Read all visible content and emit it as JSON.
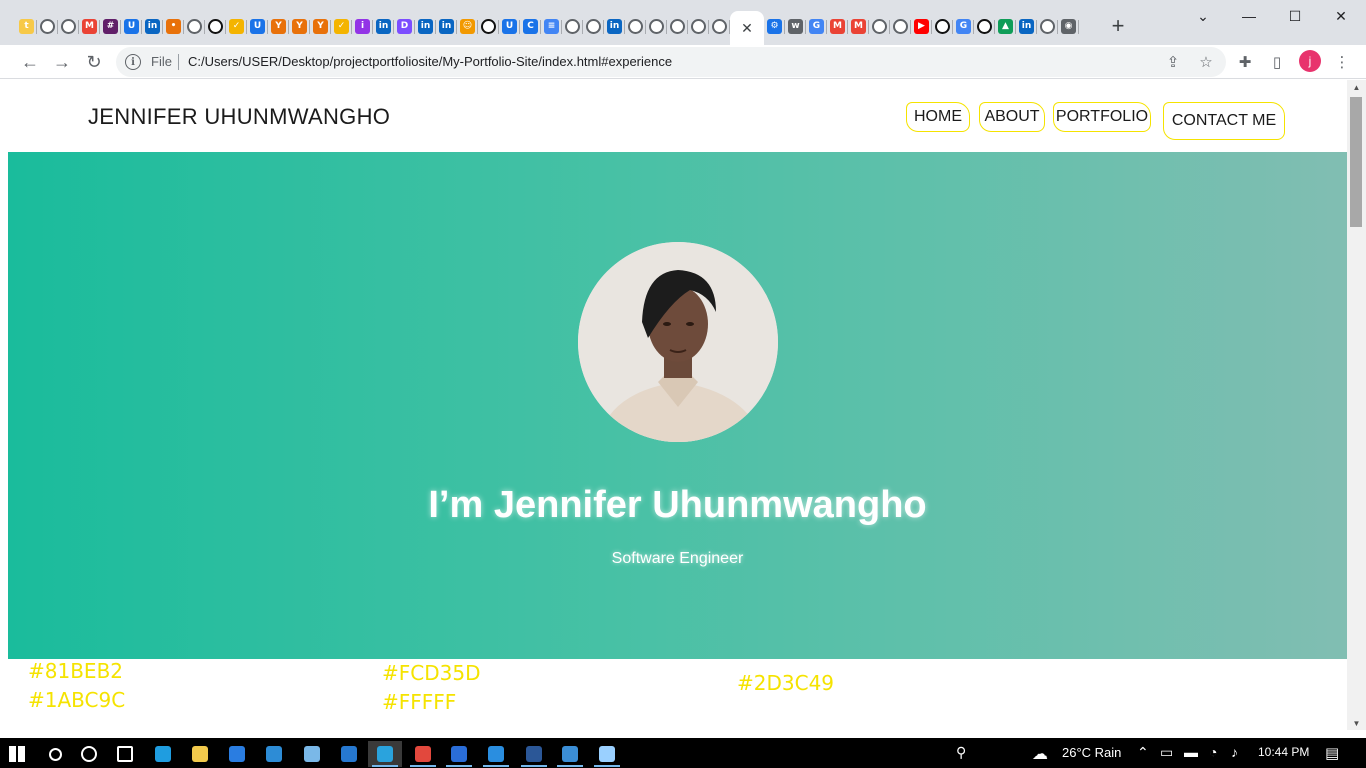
{
  "browser": {
    "tab_favicons": [
      {
        "name": "tumblr-icon",
        "glyph": "t",
        "color": "#f7c948",
        "kind": "solid"
      },
      {
        "name": "globe-icon",
        "glyph": "",
        "color": "#5f6368",
        "kind": "globe"
      },
      {
        "name": "globe-icon",
        "glyph": "",
        "color": "#5f6368",
        "kind": "globe"
      },
      {
        "name": "gmail-icon",
        "glyph": "M",
        "color": "#ea4335",
        "kind": "solid"
      },
      {
        "name": "slack-icon",
        "glyph": "#",
        "color": "#611f69",
        "kind": "solid"
      },
      {
        "name": "udemy-icon",
        "glyph": "U",
        "color": "#1a73e8",
        "kind": "solid"
      },
      {
        "name": "linkedin-icon",
        "glyph": "in",
        "color": "#0a66c2",
        "kind": "solid"
      },
      {
        "name": "app-icon",
        "glyph": "•",
        "color": "#e8710a",
        "kind": "solid"
      },
      {
        "name": "globe-icon",
        "glyph": "",
        "color": "#5f6368",
        "kind": "globe"
      },
      {
        "name": "github-icon",
        "glyph": "",
        "color": "#111",
        "kind": "gh"
      },
      {
        "name": "app-icon",
        "glyph": "✓",
        "color": "#f4b400",
        "kind": "solid"
      },
      {
        "name": "udemy-icon",
        "glyph": "U",
        "color": "#1a73e8",
        "kind": "solid"
      },
      {
        "name": "app-icon",
        "glyph": "Y",
        "color": "#e8710a",
        "kind": "solid"
      },
      {
        "name": "app-icon",
        "glyph": "Y",
        "color": "#e8710a",
        "kind": "solid"
      },
      {
        "name": "app-icon",
        "glyph": "Y",
        "color": "#e8710a",
        "kind": "solid"
      },
      {
        "name": "app-icon",
        "glyph": "✓",
        "color": "#f4b400",
        "kind": "solid"
      },
      {
        "name": "app-icon",
        "glyph": "i",
        "color": "#9334e6",
        "kind": "solid"
      },
      {
        "name": "linkedin-icon",
        "glyph": "in",
        "color": "#0a66c2",
        "kind": "solid"
      },
      {
        "name": "app-icon",
        "glyph": "D",
        "color": "#7c4dff",
        "kind": "solid"
      },
      {
        "name": "linkedin-icon",
        "glyph": "in",
        "color": "#0a66c2",
        "kind": "solid"
      },
      {
        "name": "linkedin-icon",
        "glyph": "in",
        "color": "#0a66c2",
        "kind": "solid"
      },
      {
        "name": "app-icon",
        "glyph": "☺",
        "color": "#f29900",
        "kind": "solid"
      },
      {
        "name": "github-icon",
        "glyph": "",
        "color": "#111",
        "kind": "gh"
      },
      {
        "name": "udemy-icon",
        "glyph": "U",
        "color": "#1a73e8",
        "kind": "solid"
      },
      {
        "name": "app-icon",
        "glyph": "C",
        "color": "#1a73e8",
        "kind": "solid"
      },
      {
        "name": "docs-icon",
        "glyph": "≡",
        "color": "#4285f4",
        "kind": "solid"
      },
      {
        "name": "globe-icon",
        "glyph": "",
        "color": "#5f6368",
        "kind": "globe"
      },
      {
        "name": "globe-icon",
        "glyph": "",
        "color": "#5f6368",
        "kind": "globe"
      },
      {
        "name": "linkedin-icon",
        "glyph": "in",
        "color": "#0a66c2",
        "kind": "solid"
      },
      {
        "name": "globe-icon",
        "glyph": "",
        "color": "#5f6368",
        "kind": "globe"
      },
      {
        "name": "globe-icon",
        "glyph": "",
        "color": "#5f6368",
        "kind": "globe"
      },
      {
        "name": "globe-icon",
        "glyph": "",
        "color": "#5f6368",
        "kind": "globe"
      },
      {
        "name": "globe-icon",
        "glyph": "",
        "color": "#5f6368",
        "kind": "globe"
      },
      {
        "name": "globe-icon",
        "glyph": "",
        "color": "#5f6368",
        "kind": "globe"
      }
    ],
    "tab_favicons_after": [
      {
        "name": "settings-icon",
        "glyph": "⚙",
        "color": "#1a73e8",
        "kind": "solid"
      },
      {
        "name": "app-icon",
        "glyph": "w",
        "color": "#5f6368",
        "kind": "solid"
      },
      {
        "name": "google-icon",
        "glyph": "G",
        "color": "#4285f4",
        "kind": "solid"
      },
      {
        "name": "gmail-icon",
        "glyph": "M",
        "color": "#ea4335",
        "kind": "solid"
      },
      {
        "name": "gmail-icon",
        "glyph": "M",
        "color": "#ea4335",
        "kind": "solid"
      },
      {
        "name": "globe-icon",
        "glyph": "",
        "color": "#5f6368",
        "kind": "globe"
      },
      {
        "name": "globe-icon",
        "glyph": "",
        "color": "#5f6368",
        "kind": "globe"
      },
      {
        "name": "youtube-icon",
        "glyph": "▶",
        "color": "#ff0000",
        "kind": "solid"
      },
      {
        "name": "github-icon",
        "glyph": "",
        "color": "#111",
        "kind": "gh"
      },
      {
        "name": "google-icon",
        "glyph": "G",
        "color": "#4285f4",
        "kind": "solid"
      },
      {
        "name": "github-icon",
        "glyph": "",
        "color": "#111",
        "kind": "gh"
      },
      {
        "name": "drive-icon",
        "glyph": "▲",
        "color": "#0f9d58",
        "kind": "solid"
      },
      {
        "name": "linkedin-icon",
        "glyph": "in",
        "color": "#0a66c2",
        "kind": "solid"
      },
      {
        "name": "globe-icon",
        "glyph": "",
        "color": "#5f6368",
        "kind": "globe"
      },
      {
        "name": "chrome-icon",
        "glyph": "◉",
        "color": "#5f6368",
        "kind": "solid"
      }
    ],
    "active_tab_close": "✕",
    "new_tab": "+",
    "omnibox_scheme": "File",
    "url": "C:/Users/USER/Desktop/projectportfoliosite/My-Portfolio-Site/index.html#experience",
    "profile_initial": "j"
  },
  "site": {
    "brand": "JENNIFER UHUNMWANGHO",
    "nav": [
      "HOME",
      "ABOUT",
      "PORTFOLIO",
      "CONTACT ME"
    ],
    "hero_title": "I’m Jennifer Uhunmwangho",
    "hero_subtitle": "Software Engineer",
    "colors": {
      "gradient_start": "#1abc9c",
      "gradient_end": "#81beb2",
      "nav_outline": "#f5e300",
      "swatch_text": "#f5e300"
    },
    "swatches": [
      [
        "#81BEB2",
        "#1ABC9C"
      ],
      [
        "#FCD35D",
        "#FFFFF"
      ],
      [
        "#2D3C49"
      ]
    ]
  },
  "taskbar": {
    "weather": "26°C  Rain",
    "time": "10:44 PM",
    "apps": [
      "windows-start-icon",
      "search-icon",
      "cortana-icon",
      "task-view-icon",
      "edge-icon",
      "file-explorer-icon",
      "store-icon",
      "keyboard-icon",
      "notepad-icon",
      "mail-icon",
      "telegram-icon",
      "chrome-icon",
      "media-icon",
      "vscode-icon",
      "word-icon",
      "photos-icon",
      "paint-icon"
    ]
  }
}
